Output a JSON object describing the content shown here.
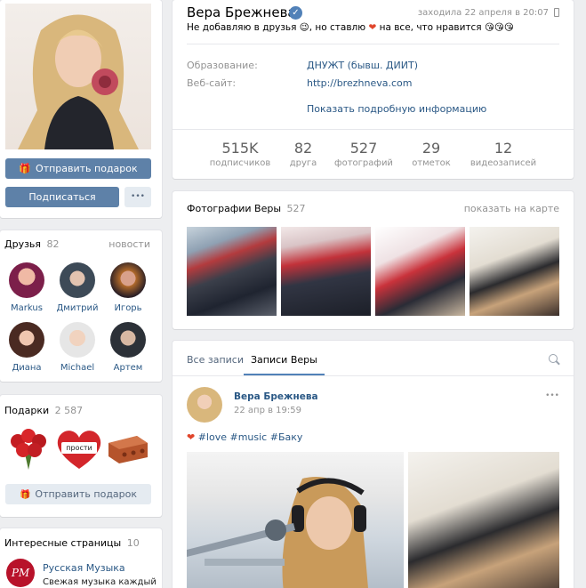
{
  "profile": {
    "name": "Вера Брежнева",
    "last_seen": "заходила 22 апреля в 20:07",
    "status_parts": [
      "Не добавляю в друзья",
      ", но ставлю",
      "на все, что нравится"
    ],
    "education_label": "Образование:",
    "education_value": "ДНУЖТ (бывш. ДИИТ)",
    "website_label": "Веб-сайт:",
    "website_value": "http://brezhneva.com",
    "show_more": "Показать подробную информацию",
    "colors": {
      "link": "#2a5885",
      "button": "#5e81a8",
      "verified": "#5181b8"
    }
  },
  "actions": {
    "send_gift": "Отправить подарок",
    "subscribe": "Подписаться",
    "more": "•••"
  },
  "stats": [
    {
      "value": "515K",
      "label": "подписчиков"
    },
    {
      "value": "82",
      "label": "друга"
    },
    {
      "value": "527",
      "label": "фотографий"
    },
    {
      "value": "29",
      "label": "отметок"
    },
    {
      "value": "12",
      "label": "видеозаписей"
    }
  ],
  "friends": {
    "title": "Друзья",
    "count": "82",
    "news": "новости",
    "items": [
      {
        "name": "Markus"
      },
      {
        "name": "Дмитрий"
      },
      {
        "name": "Игорь"
      },
      {
        "name": "Диана"
      },
      {
        "name": "Michael"
      },
      {
        "name": "Артем"
      }
    ]
  },
  "gifts": {
    "title": "Подарки",
    "count": "2 587",
    "heart_text": "прости",
    "send_gift": "Отправить подарок"
  },
  "pages": {
    "title": "Интересные страницы",
    "count": "10",
    "item_name": "Русская Музыка",
    "item_desc": "Свежая музыка каждый",
    "logo_text": "РМ"
  },
  "photos": {
    "title": "Фотографии Веры",
    "count": "527",
    "map_link": "показать на карте"
  },
  "wall": {
    "tab_all": "Все записи",
    "tab_own": "Записи Веры",
    "post_author": "Вера Брежнева",
    "post_date": "22 апр в 19:59",
    "post_text": "#love #music #Баку",
    "more": "•••"
  }
}
